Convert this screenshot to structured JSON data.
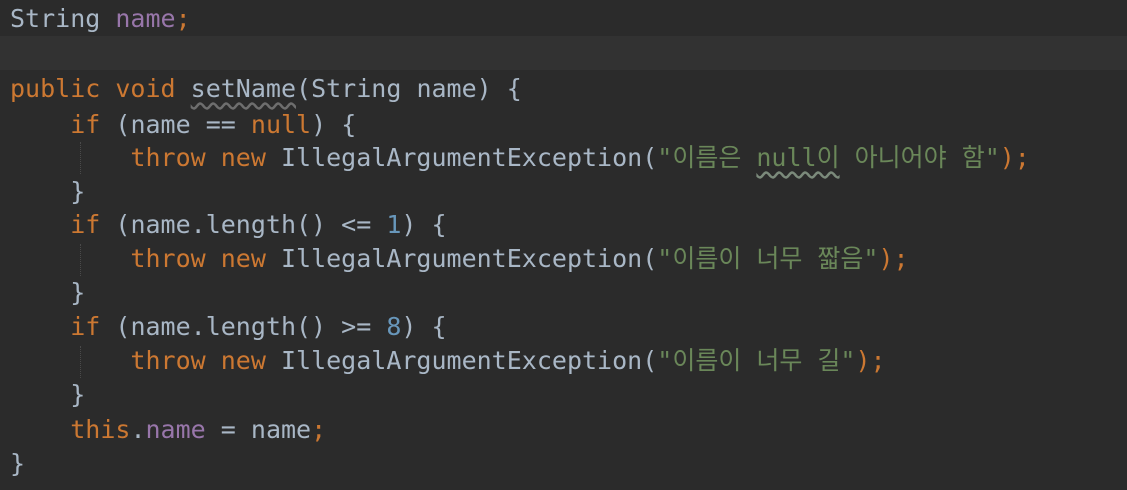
{
  "editor": {
    "lines": [
      {
        "parts": [
          {
            "t": "String",
            "c": "type"
          },
          {
            "t": " ",
            "c": "ws"
          },
          {
            "t": "name",
            "c": "field"
          },
          {
            "t": ";",
            "c": "kw"
          }
        ]
      },
      {
        "parts": []
      },
      {
        "parts": [
          {
            "t": "public",
            "c": "kw"
          },
          {
            "t": " ",
            "c": "ws"
          },
          {
            "t": "void",
            "c": "kw"
          },
          {
            "t": " ",
            "c": "ws"
          },
          {
            "t": "setName",
            "c": "type",
            "u": "warn-plain"
          },
          {
            "t": "(String",
            "c": "type"
          },
          {
            "t": " ",
            "c": "ws"
          },
          {
            "t": "name)",
            "c": "type"
          },
          {
            "t": " ",
            "c": "ws"
          },
          {
            "t": "{",
            "c": "type"
          }
        ]
      },
      {
        "parts": [
          {
            "t": "    ",
            "c": "ws"
          },
          {
            "t": "if",
            "c": "kw"
          },
          {
            "t": " ",
            "c": "ws"
          },
          {
            "t": "(name",
            "c": "type"
          },
          {
            "t": " ",
            "c": "ws"
          },
          {
            "t": "==",
            "c": "type"
          },
          {
            "t": " ",
            "c": "ws"
          },
          {
            "t": "null",
            "c": "kw"
          },
          {
            "t": ")",
            "c": "type"
          },
          {
            "t": " ",
            "c": "ws"
          },
          {
            "t": "{",
            "c": "type"
          }
        ]
      },
      {
        "parts": [
          {
            "t": "        ",
            "c": "ws"
          },
          {
            "t": "throw",
            "c": "kw"
          },
          {
            "t": " ",
            "c": "ws"
          },
          {
            "t": "new",
            "c": "kw"
          },
          {
            "t": " ",
            "c": "ws"
          },
          {
            "t": "IllegalArgumentException(",
            "c": "type"
          },
          {
            "t": "\"이름은 ",
            "c": "str"
          },
          {
            "t": "null이",
            "c": "str",
            "u": "warn"
          },
          {
            "t": " 아니어야 함\"",
            "c": "str"
          },
          {
            "t": ");",
            "c": "kw"
          }
        ]
      },
      {
        "parts": [
          {
            "t": "    ",
            "c": "ws"
          },
          {
            "t": "}",
            "c": "type"
          }
        ]
      },
      {
        "parts": [
          {
            "t": "    ",
            "c": "ws"
          },
          {
            "t": "if",
            "c": "kw"
          },
          {
            "t": " ",
            "c": "ws"
          },
          {
            "t": "(name.length()",
            "c": "type"
          },
          {
            "t": " ",
            "c": "ws"
          },
          {
            "t": "<=",
            "c": "type"
          },
          {
            "t": " ",
            "c": "ws"
          },
          {
            "t": "1",
            "c": "num"
          },
          {
            "t": ")",
            "c": "type"
          },
          {
            "t": " ",
            "c": "ws"
          },
          {
            "t": "{",
            "c": "type"
          }
        ]
      },
      {
        "parts": [
          {
            "t": "        ",
            "c": "ws"
          },
          {
            "t": "throw",
            "c": "kw"
          },
          {
            "t": " ",
            "c": "ws"
          },
          {
            "t": "new",
            "c": "kw"
          },
          {
            "t": " ",
            "c": "ws"
          },
          {
            "t": "IllegalArgumentException(",
            "c": "type"
          },
          {
            "t": "\"이름이 너무 짧음\"",
            "c": "str"
          },
          {
            "t": ");",
            "c": "kw"
          }
        ]
      },
      {
        "parts": [
          {
            "t": "    ",
            "c": "ws"
          },
          {
            "t": "}",
            "c": "type"
          }
        ]
      },
      {
        "parts": [
          {
            "t": "    ",
            "c": "ws"
          },
          {
            "t": "if",
            "c": "kw"
          },
          {
            "t": " ",
            "c": "ws"
          },
          {
            "t": "(name.length()",
            "c": "type"
          },
          {
            "t": " ",
            "c": "ws"
          },
          {
            "t": ">=",
            "c": "type"
          },
          {
            "t": " ",
            "c": "ws"
          },
          {
            "t": "8",
            "c": "num"
          },
          {
            "t": ")",
            "c": "type"
          },
          {
            "t": " ",
            "c": "ws"
          },
          {
            "t": "{",
            "c": "type"
          }
        ]
      },
      {
        "parts": [
          {
            "t": "        ",
            "c": "ws"
          },
          {
            "t": "throw",
            "c": "kw"
          },
          {
            "t": " ",
            "c": "ws"
          },
          {
            "t": "new",
            "c": "kw"
          },
          {
            "t": " ",
            "c": "ws"
          },
          {
            "t": "IllegalArgumentException(",
            "c": "type"
          },
          {
            "t": "\"이름이 너무 길\"",
            "c": "str"
          },
          {
            "t": ");",
            "c": "kw"
          }
        ]
      },
      {
        "parts": [
          {
            "t": "    ",
            "c": "ws"
          },
          {
            "t": "}",
            "c": "type"
          }
        ]
      },
      {
        "parts": [
          {
            "t": "    ",
            "c": "ws"
          },
          {
            "t": "this",
            "c": "kw"
          },
          {
            "t": ".",
            "c": "type"
          },
          {
            "t": "name",
            "c": "field"
          },
          {
            "t": " ",
            "c": "ws"
          },
          {
            "t": "=",
            "c": "type"
          },
          {
            "t": " ",
            "c": "ws"
          },
          {
            "t": "name",
            "c": "type"
          },
          {
            "t": ";",
            "c": "kw"
          }
        ]
      },
      {
        "parts": [
          {
            "t": "}",
            "c": "type"
          }
        ]
      }
    ]
  },
  "colors": {
    "background": "#2b2b2b",
    "current_line": "#323232",
    "keyword": "#cc7832",
    "field": "#9876aa",
    "string": "#6a8759",
    "number": "#6897bb",
    "text": "#a9b7c6"
  }
}
